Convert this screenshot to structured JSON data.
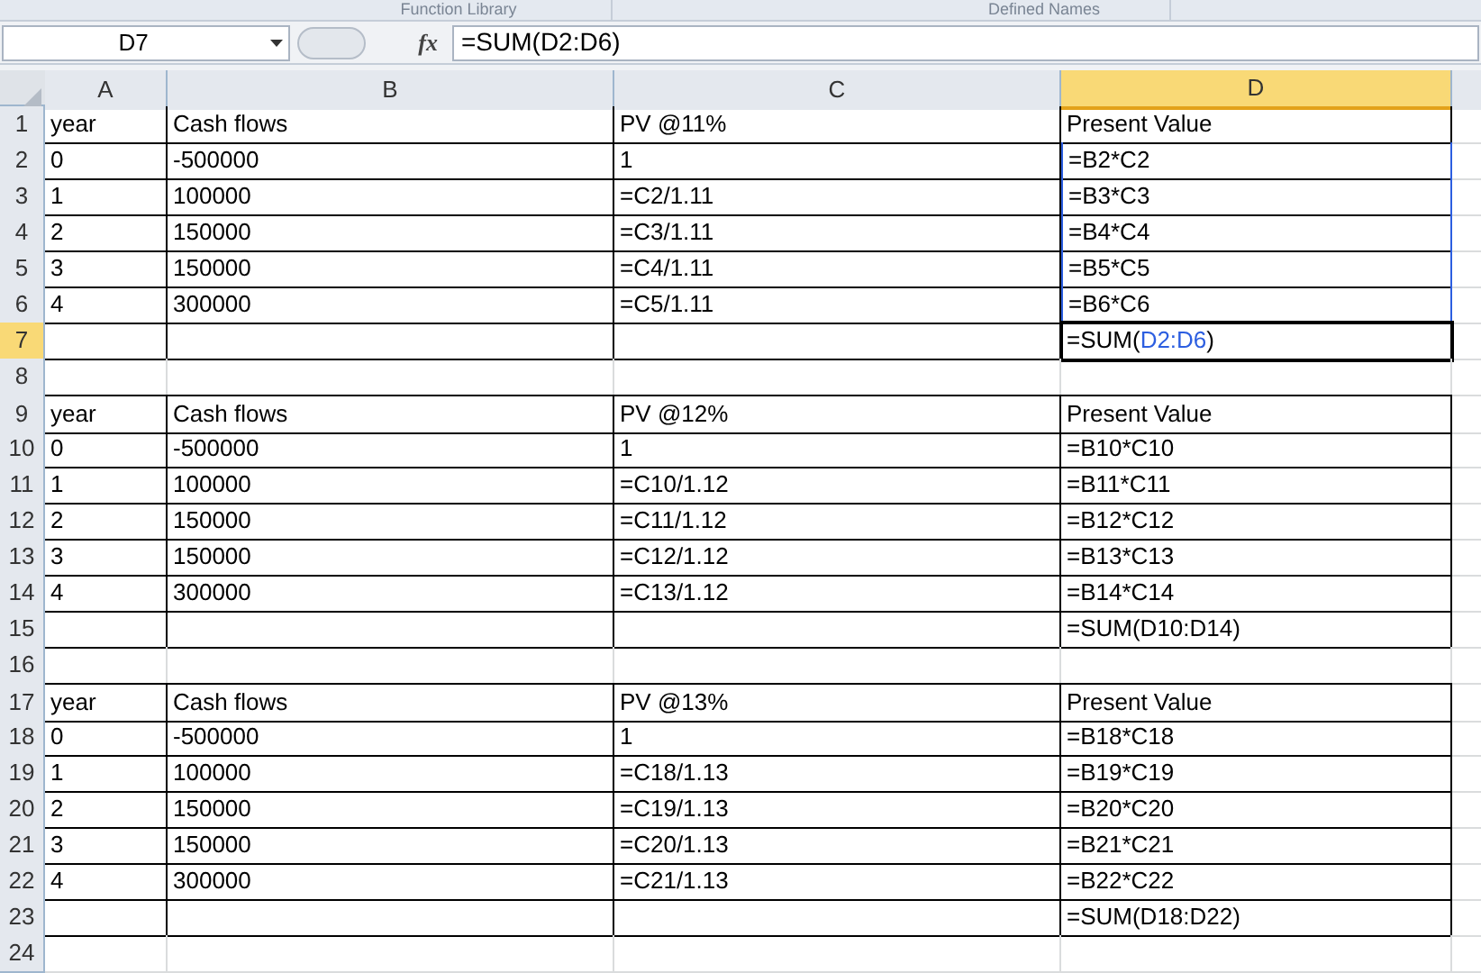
{
  "ribbon_groups": [
    "Function Library",
    "Defined Names"
  ],
  "name_box": "D7",
  "formula_bar": {
    "fx": "fx",
    "value": "=SUM(D2:D6)"
  },
  "columns": [
    {
      "label": "A",
      "selected": false
    },
    {
      "label": "B",
      "selected": false
    },
    {
      "label": "C",
      "selected": false
    },
    {
      "label": "D",
      "selected": true
    }
  ],
  "rows": [
    {
      "number": "1",
      "selected": false,
      "bordered": true,
      "referenced": false,
      "cells": [
        "year",
        "Cash flows",
        "PV @11%",
        "Present Value"
      ]
    },
    {
      "number": "2",
      "selected": false,
      "bordered": true,
      "referenced": true,
      "cells": [
        "0",
        "-500000",
        "1",
        "=B2*C2"
      ]
    },
    {
      "number": "3",
      "selected": false,
      "bordered": true,
      "referenced": true,
      "cells": [
        "1",
        "100000",
        "=C2/1.11",
        "=B3*C3"
      ]
    },
    {
      "number": "4",
      "selected": false,
      "bordered": true,
      "referenced": true,
      "cells": [
        "2",
        "150000",
        "=C3/1.11",
        "=B4*C4"
      ]
    },
    {
      "number": "5",
      "selected": false,
      "bordered": true,
      "referenced": true,
      "cells": [
        "3",
        "150000",
        "=C4/1.11",
        "=B5*C5"
      ]
    },
    {
      "number": "6",
      "selected": false,
      "bordered": true,
      "referenced": true,
      "cells": [
        "4",
        "300000",
        "=C5/1.11",
        "=B6*C6"
      ]
    },
    {
      "number": "7",
      "selected": true,
      "bordered": true,
      "referenced": false,
      "cells": [
        "",
        "",
        "",
        {
          "parts": [
            {
              "text": "=SUM("
            },
            {
              "text": "D2:D6",
              "kind": "reference"
            },
            {
              "text": ")"
            }
          ]
        }
      ]
    },
    {
      "number": "8",
      "selected": false,
      "bordered": false,
      "referenced": false,
      "cells": [
        "",
        "",
        "",
        ""
      ]
    },
    {
      "number": "9",
      "selected": false,
      "bordered": true,
      "referenced": false,
      "cells": [
        "year",
        "Cash flows",
        "PV @12%",
        "Present Value"
      ]
    },
    {
      "number": "10",
      "selected": false,
      "bordered": true,
      "referenced": false,
      "cells": [
        "0",
        "-500000",
        "1",
        "=B10*C10"
      ]
    },
    {
      "number": "11",
      "selected": false,
      "bordered": true,
      "referenced": false,
      "cells": [
        "1",
        "100000",
        "=C10/1.12",
        "=B11*C11"
      ]
    },
    {
      "number": "12",
      "selected": false,
      "bordered": true,
      "referenced": false,
      "cells": [
        "2",
        "150000",
        "=C11/1.12",
        "=B12*C12"
      ]
    },
    {
      "number": "13",
      "selected": false,
      "bordered": true,
      "referenced": false,
      "cells": [
        "3",
        "150000",
        "=C12/1.12",
        "=B13*C13"
      ]
    },
    {
      "number": "14",
      "selected": false,
      "bordered": true,
      "referenced": false,
      "cells": [
        "4",
        "300000",
        "=C13/1.12",
        "=B14*C14"
      ]
    },
    {
      "number": "15",
      "selected": false,
      "bordered": true,
      "referenced": false,
      "cells": [
        "",
        "",
        "",
        "=SUM(D10:D14)"
      ]
    },
    {
      "number": "16",
      "selected": false,
      "bordered": false,
      "referenced": false,
      "cells": [
        "",
        "",
        "",
        ""
      ]
    },
    {
      "number": "17",
      "selected": false,
      "bordered": true,
      "referenced": false,
      "cells": [
        "year",
        "Cash flows",
        "PV @13%",
        "Present Value"
      ]
    },
    {
      "number": "18",
      "selected": false,
      "bordered": true,
      "referenced": false,
      "cells": [
        "0",
        "-500000",
        "1",
        "=B18*C18"
      ]
    },
    {
      "number": "19",
      "selected": false,
      "bordered": true,
      "referenced": false,
      "cells": [
        "1",
        "100000",
        "=C18/1.13",
        "=B19*C19"
      ]
    },
    {
      "number": "20",
      "selected": false,
      "bordered": true,
      "referenced": false,
      "cells": [
        "2",
        "150000",
        "=C19/1.13",
        "=B20*C20"
      ]
    },
    {
      "number": "21",
      "selected": false,
      "bordered": true,
      "referenced": false,
      "cells": [
        "3",
        "150000",
        "=C20/1.13",
        "=B21*C21"
      ]
    },
    {
      "number": "22",
      "selected": false,
      "bordered": true,
      "referenced": false,
      "cells": [
        "4",
        "300000",
        "=C21/1.13",
        "=B22*C22"
      ]
    },
    {
      "number": "23",
      "selected": false,
      "bordered": true,
      "referenced": false,
      "cells": [
        "",
        "",
        "",
        "=SUM(D18:D22)"
      ]
    },
    {
      "number": "24",
      "selected": false,
      "bordered": false,
      "referenced": false,
      "cells": [
        "",
        "",
        "",
        ""
      ]
    }
  ]
}
